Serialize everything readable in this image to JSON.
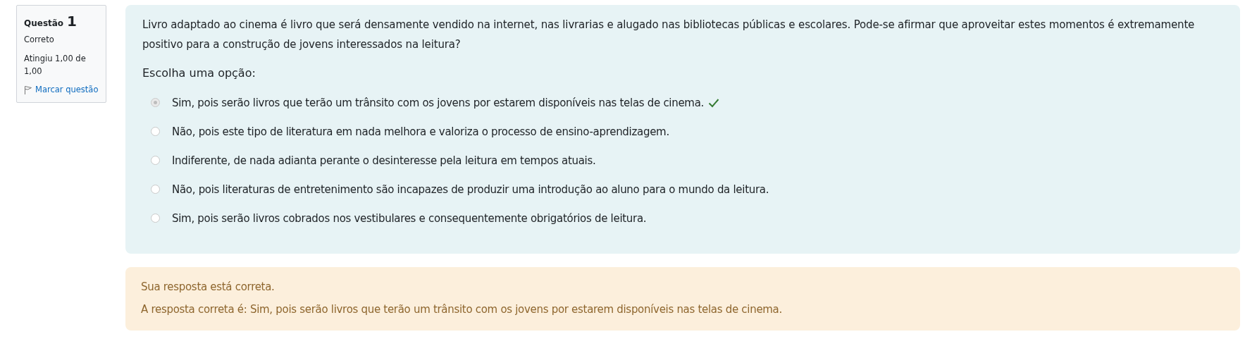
{
  "info": {
    "label": "Questão",
    "number": "1",
    "state": "Correto",
    "grade": "Atingiu 1,00 de 1,00",
    "flag_link": "Marcar questão"
  },
  "question": {
    "text": "Livro adaptado ao cinema é livro que será densamente vendido na internet, nas livrarias e alugado nas bibliotecas públicas e escolares. Pode-se afirmar que aproveitar estes momentos é extremamente positivo para a construção de jovens interessados na leitura?",
    "prompt": "Escolha uma opção:",
    "options": [
      {
        "text": "Sim, pois serão livros que terão um trânsito com os jovens por estarem disponíveis nas telas de cinema.",
        "selected": true,
        "correct": true
      },
      {
        "text": "Não, pois este tipo de literatura em nada melhora e valoriza o processo de ensino-aprendizagem.",
        "selected": false,
        "correct": false
      },
      {
        "text": "Indiferente, de nada adianta perante o desinteresse pela leitura em tempos atuais.",
        "selected": false,
        "correct": false
      },
      {
        "text": "Não, pois literaturas de entretenimento são incapazes de produzir uma introdução ao aluno para o mundo da leitura.",
        "selected": false,
        "correct": false
      },
      {
        "text": "Sim, pois serão livros cobrados nos vestibulares e consequentemente obrigatórios de leitura.",
        "selected": false,
        "correct": false
      }
    ]
  },
  "feedback": {
    "status": "Sua resposta está correta.",
    "right_answer": "A resposta correta é: Sim, pois serão livros que terão um trânsito com os jovens por estarem disponíveis nas telas de cinema."
  }
}
